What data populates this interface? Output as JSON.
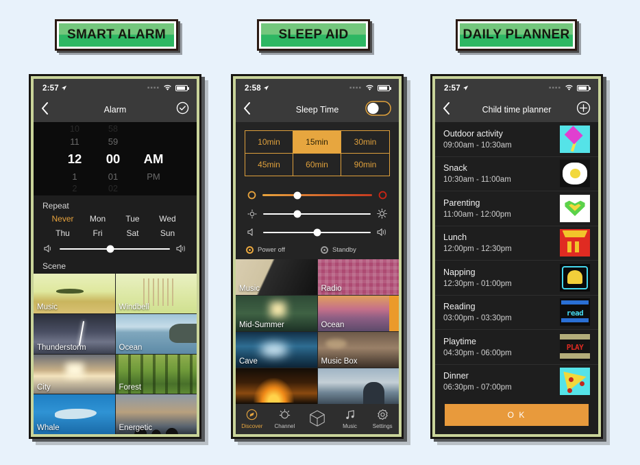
{
  "page": {
    "background_color": "#e8f2fb",
    "badge_colors": {
      "top": "#74c77d",
      "bottom": "#2eb763",
      "border": "#2a1a14"
    }
  },
  "panels": [
    {
      "badge_label": "SMART ALARM",
      "status": {
        "time": "2:57",
        "location_icon": "location-arrow-icon",
        "signal_icon": "dots-icon",
        "wifi_icon": "wifi-icon",
        "battery_icon": "battery-icon"
      },
      "nav": {
        "back_icon": "chevron-left-icon",
        "title": "Alarm",
        "action_icon": "check-circle-icon"
      },
      "picker": {
        "hours": {
          "far": "10",
          "near": "11",
          "selected": "12",
          "after": "1",
          "far_after": "2"
        },
        "minutes": {
          "far": "58",
          "near": "59",
          "selected": "00",
          "after": "01",
          "far_after": "02"
        },
        "meridiem": {
          "selected": "AM",
          "after": "PM"
        }
      },
      "repeat": {
        "label": "Repeat",
        "options": [
          "Never",
          "Mon",
          "Tue",
          "Wed",
          "Thu",
          "Fri",
          "Sat",
          "Sun"
        ],
        "selected": "Never",
        "selected_color": "#e8a33d"
      },
      "volume": {
        "left_icon": "volume-low-icon",
        "right_icon": "volume-high-icon",
        "value_percent": 46
      },
      "scene": {
        "label": "Scene",
        "tiles": [
          {
            "label": "Music",
            "art": "a-music"
          },
          {
            "label": "Windbell",
            "art": "a-wind"
          },
          {
            "label": "Thunderstorm",
            "art": "a-thunder"
          },
          {
            "label": "Ocean",
            "art": "a-ocean"
          },
          {
            "label": "City",
            "art": "a-city"
          },
          {
            "label": "Forest",
            "art": "a-forest"
          },
          {
            "label": "Whale",
            "art": "a-whale"
          },
          {
            "label": "Energetic",
            "art": "a-energ"
          }
        ]
      }
    },
    {
      "badge_label": "SLEEP AID",
      "status": {
        "time": "2:58",
        "location_icon": "location-arrow-icon",
        "signal_icon": "dots-icon",
        "wifi_icon": "wifi-icon",
        "battery_icon": "battery-icon"
      },
      "nav": {
        "back_icon": "chevron-left-icon",
        "title": "Sleep Time",
        "action_icon": "toggle-switch-off-icon"
      },
      "timers": {
        "options": [
          "10min",
          "15min",
          "30min",
          "45min",
          "60min",
          "90min"
        ],
        "selected": "15min",
        "accent_color": "#e0a13c"
      },
      "sliders": [
        {
          "name": "color-temperature",
          "left_icon": "circle-warm-icon",
          "right_icon": "circle-red-icon",
          "value_percent": 32,
          "style": "warm"
        },
        {
          "name": "brightness",
          "left_icon": "brightness-low-icon",
          "right_icon": "brightness-high-icon",
          "value_percent": 32,
          "style": "plain"
        },
        {
          "name": "volume",
          "left_icon": "volume-low-icon",
          "right_icon": "volume-high-icon",
          "value_percent": 50,
          "style": "plain"
        }
      ],
      "radios": [
        {
          "label": "Power off",
          "selected": true
        },
        {
          "label": "Standby",
          "selected": false
        }
      ],
      "sounds": [
        {
          "label": "Music",
          "art": "b-music"
        },
        {
          "label": "Radio",
          "art": "b-radio"
        },
        {
          "label": "Mid-Summer",
          "art": "b-mid"
        },
        {
          "label": "Ocean",
          "art": "b-oce"
        },
        {
          "label": "Cave",
          "art": "b-cave"
        },
        {
          "label": "Music Box",
          "art": "b-box"
        },
        {
          "label": "",
          "art": "b-fire"
        },
        {
          "label": "",
          "art": "b-sea"
        }
      ],
      "tabs": [
        {
          "label": "Discover",
          "icon": "compass-icon",
          "active": true
        },
        {
          "label": "Channel",
          "icon": "sun-icon",
          "active": false
        },
        {
          "label": "",
          "icon": "cube-icon",
          "active": false
        },
        {
          "label": "Music",
          "icon": "music-note-icon",
          "active": false
        },
        {
          "label": "Settings",
          "icon": "gear-icon",
          "active": false
        }
      ]
    },
    {
      "badge_label": "DAILY PLANNER",
      "status": {
        "time": "2:57",
        "location_icon": "location-arrow-icon",
        "signal_icon": "dots-icon",
        "wifi_icon": "wifi-icon",
        "battery_icon": "battery-icon"
      },
      "nav": {
        "back_icon": "chevron-left-icon",
        "title": "Child time planner",
        "action_icon": "plus-circle-icon"
      },
      "items": [
        {
          "title": "Outdoor activity",
          "time": "09:00am - 10:30am",
          "thumb": "t-kite",
          "thumb_name": "kite-thumbnail",
          "glyph": ""
        },
        {
          "title": "Snack",
          "time": "10:30am - 11:00am",
          "thumb": "t-egg",
          "thumb_name": "fried-egg-thumbnail",
          "glyph": ""
        },
        {
          "title": "Parenting",
          "time": "11:00am - 12:00pm",
          "thumb": "t-heart",
          "thumb_name": "heart-thumbnail",
          "glyph": ""
        },
        {
          "title": "Lunch",
          "time": "12:00pm - 12:30pm",
          "thumb": "t-fries",
          "thumb_name": "fries-thumbnail",
          "glyph": ""
        },
        {
          "title": "Napping",
          "time": "12:30pm - 01:00pm",
          "thumb": "t-bell",
          "thumb_name": "bell-thumbnail",
          "glyph": ""
        },
        {
          "title": "Reading",
          "time": "03:00pm - 03:30pm",
          "thumb": "t-read",
          "thumb_name": "read-thumbnail",
          "glyph": "read"
        },
        {
          "title": "Playtime",
          "time": "04:30pm - 06:00pm",
          "thumb": "t-play",
          "thumb_name": "play-thumbnail",
          "glyph": "PLAY"
        },
        {
          "title": "Dinner",
          "time": "06:30pm - 07:00pm",
          "thumb": "t-pizza",
          "thumb_name": "pizza-thumbnail",
          "glyph": ""
        }
      ],
      "ok_button": {
        "label": "O K",
        "color": "#e89a3c"
      }
    }
  ]
}
